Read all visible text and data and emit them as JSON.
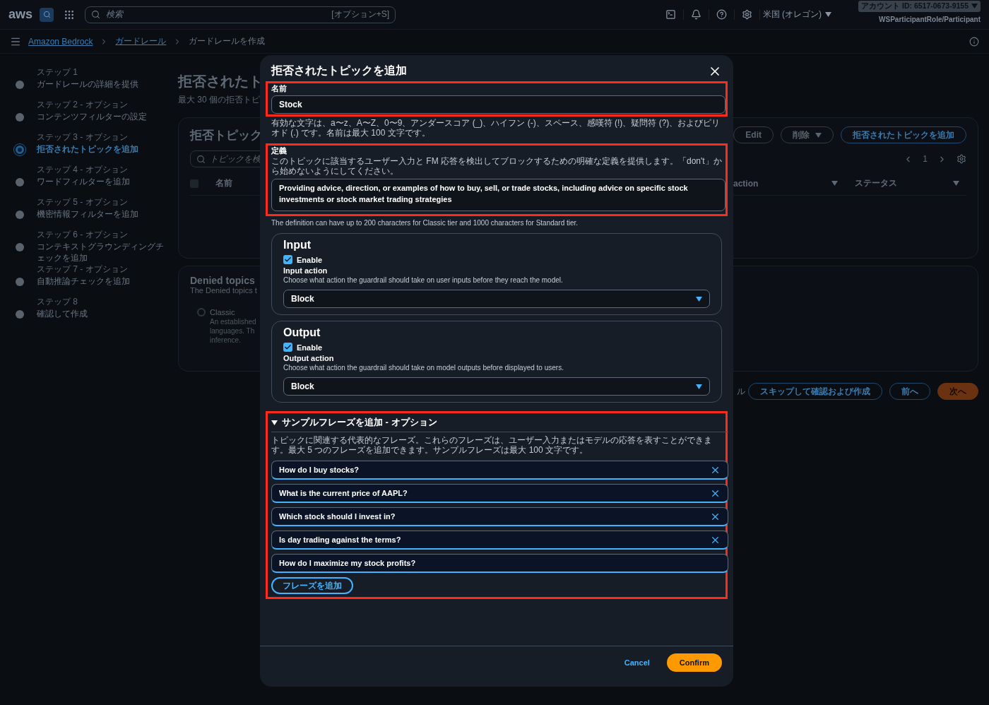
{
  "top_bar": {
    "logo": "aws",
    "search": {
      "placeholder": "検索",
      "shortcut": "[オプション+S]"
    },
    "region": "米国 (オレゴン)",
    "account": "アカウント ID: 6517-0673-9155",
    "role": "WSParticipantRole/Participant"
  },
  "breadcrumbs": [
    {
      "label": "Amazon Bedrock",
      "link": true
    },
    {
      "label": "ガードレール",
      "link": true
    },
    {
      "label": "ガードレールを作成",
      "link": false
    }
  ],
  "steps": [
    {
      "label": "ステップ 1",
      "title": "ガードレールの詳細を提供",
      "selected": false
    },
    {
      "label": "ステップ 2 - オプション",
      "title": "コンテンツフィルターの設定",
      "selected": false
    },
    {
      "label": "ステップ 3 - オプション",
      "title": "拒否されたトピックを追加",
      "selected": true
    },
    {
      "label": "ステップ 4 - オプション",
      "title": "ワードフィルターを追加",
      "selected": false
    },
    {
      "label": "ステップ 5 - オプション",
      "title": "機密情報フィルターを追加",
      "selected": false
    },
    {
      "label": "ステップ 6 - オプション",
      "title": "コンテキストグラウンディングチェックを追加",
      "selected": false
    },
    {
      "label": "ステップ 7 - オプション",
      "title": "自動推論チェックを追加",
      "selected": false
    },
    {
      "label": "ステップ 8",
      "title": "確認して作成",
      "selected": false
    }
  ],
  "page": {
    "title": "拒否されたト",
    "subtitle": "最大 30 個の拒否トピ",
    "topics_card": {
      "title": "拒否トピック",
      "search_placeholder": "トピックを検",
      "buttons": [
        {
          "label": "Edit",
          "kind": "normal"
        },
        {
          "label": "削除",
          "kind": "dropdown"
        },
        {
          "label": "拒否されたトピックを追加",
          "kind": "primary"
        }
      ],
      "page_number": "1",
      "select_all_checked": false,
      "columns": [
        "名前",
        "action",
        "ステータス"
      ]
    },
    "tier_card": {
      "title": "Denied topics",
      "description": "The Denied topics t",
      "option": {
        "label": "Classic",
        "selected": false,
        "lines": [
          "An established",
          "languages. Th",
          "inference."
        ]
      }
    },
    "footer_buttons": [
      {
        "label": "ル",
        "kind": "link"
      },
      {
        "label": "スキップして確認および作成",
        "kind": "secondary"
      },
      {
        "label": "前へ",
        "kind": "secondary"
      },
      {
        "label": "次へ",
        "kind": "primary"
      }
    ]
  },
  "modal": {
    "title": "拒否されたトピックを追加",
    "name_field": {
      "highlighted": true,
      "label": "名前",
      "value": "Stock",
      "hint": "有効な文字は、a〜z、A〜Z、0〜9、アンダースコア (_)、ハイフン (-)、スペース、感嘆符 (!)、疑問符 (?)、およびピリオド (.) です。名前は最大 100 文字です。"
    },
    "definition_field": {
      "highlighted": true,
      "label": "定義",
      "description": "このトピックに該当するユーザー入力と FM 応答を検出してブロックするための明確な定義を提供します。「don't」から始めないようにしてください。",
      "value": "Providing advice, direction, or examples of how to buy, sell, or trade stocks, including advice on specific stock investments or stock market trading strategies",
      "hint": "The definition can have up to 200 characters for Classic tier and 1000 characters for Standard tier."
    },
    "sections": [
      {
        "title": "Input",
        "enabled": true,
        "enable_label": "Enable",
        "action_label": "Input action",
        "action_description": "Choose what action the guardrail should take on user inputs before they reach the model.",
        "action": "Block"
      },
      {
        "title": "Output",
        "enabled": true,
        "enable_label": "Enable",
        "action_label": "Output action",
        "action_description": "Choose what action the guardrail should take on model outputs before displayed to users.",
        "action": "Block"
      }
    ],
    "sample_phrases": {
      "highlighted": true,
      "expanded": true,
      "title": "サンプルフレーズを追加 - オプション",
      "description": "トピックに関連する代表的なフレーズ。これらのフレーズは、ユーザー入力またはモデルの応答を表すことができます。最大 5 つのフレーズを追加できます。サンプルフレーズは最大 100 文字です。",
      "phrases": [
        {
          "value": "How do I buy stocks?",
          "removable": true
        },
        {
          "value": "What is the current price of AAPL?",
          "removable": true
        },
        {
          "value": "Which stock should I invest in?",
          "removable": true
        },
        {
          "value": "Is day trading against the terms?",
          "removable": true
        },
        {
          "value": "How do I maximize my stock profits?",
          "removable": false
        }
      ],
      "add_button": "フレーズを追加"
    },
    "cancel": "Cancel",
    "confirm": "Confirm"
  }
}
